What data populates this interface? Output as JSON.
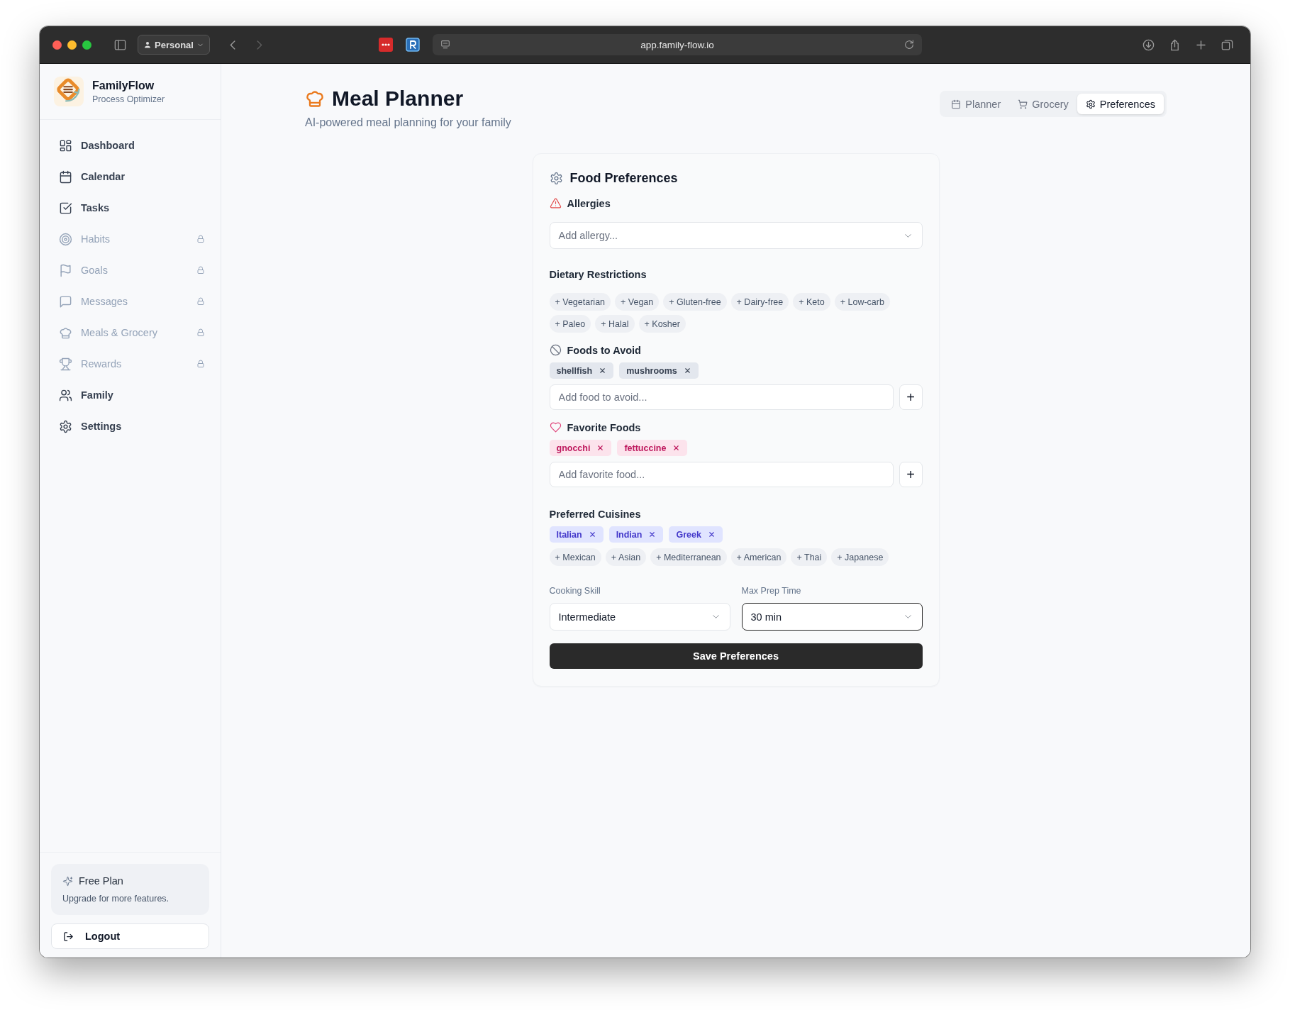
{
  "browser": {
    "profile": "Personal",
    "url": "app.family-flow.io"
  },
  "sidebar": {
    "brand": {
      "name": "FamilyFlow",
      "tagline": "Process Optimizer"
    },
    "items": [
      {
        "label": "Dashboard",
        "locked": false
      },
      {
        "label": "Calendar",
        "locked": false
      },
      {
        "label": "Tasks",
        "locked": false
      },
      {
        "label": "Habits",
        "locked": true
      },
      {
        "label": "Goals",
        "locked": true
      },
      {
        "label": "Messages",
        "locked": true
      },
      {
        "label": "Meals & Grocery",
        "locked": true
      },
      {
        "label": "Rewards",
        "locked": true
      },
      {
        "label": "Family",
        "locked": false
      },
      {
        "label": "Settings",
        "locked": false
      }
    ],
    "plan": {
      "title": "Free Plan",
      "text": "Upgrade for more features."
    },
    "logout": "Logout"
  },
  "header": {
    "title": "Meal Planner",
    "subtitle": "AI-powered meal planning for your family",
    "tabs": [
      {
        "label": "Planner",
        "selected": false
      },
      {
        "label": "Grocery",
        "selected": false
      },
      {
        "label": "Preferences",
        "selected": true
      }
    ]
  },
  "preferences": {
    "title": "Food Preferences",
    "allergies": {
      "label": "Allergies",
      "placeholder": "Add allergy..."
    },
    "dietary": {
      "label": "Dietary Restrictions",
      "options": [
        "+ Vegetarian",
        "+ Vegan",
        "+ Gluten-free",
        "+ Dairy-free",
        "+ Keto",
        "+ Low-carb",
        "+ Paleo",
        "+ Halal",
        "+ Kosher"
      ]
    },
    "avoid": {
      "label": "Foods to Avoid",
      "tags": [
        "shellfish",
        "mushrooms"
      ],
      "placeholder": "Add food to avoid...",
      "add": "+"
    },
    "favorites": {
      "label": "Favorite Foods",
      "tags": [
        "gnocchi",
        "fettuccine"
      ],
      "placeholder": "Add favorite food...",
      "add": "+"
    },
    "cuisines": {
      "label": "Preferred Cuisines",
      "tags": [
        "Italian",
        "Indian",
        "Greek"
      ],
      "options": [
        "+ Mexican",
        "+ Asian",
        "+ Mediterranean",
        "+ American",
        "+ Thai",
        "+ Japanese"
      ]
    },
    "cooking_skill": {
      "label": "Cooking Skill",
      "value": "Intermediate",
      "focused": false
    },
    "max_prep_time": {
      "label": "Max Prep Time",
      "value": "30 min",
      "focused": true
    },
    "save": "Save Preferences"
  }
}
